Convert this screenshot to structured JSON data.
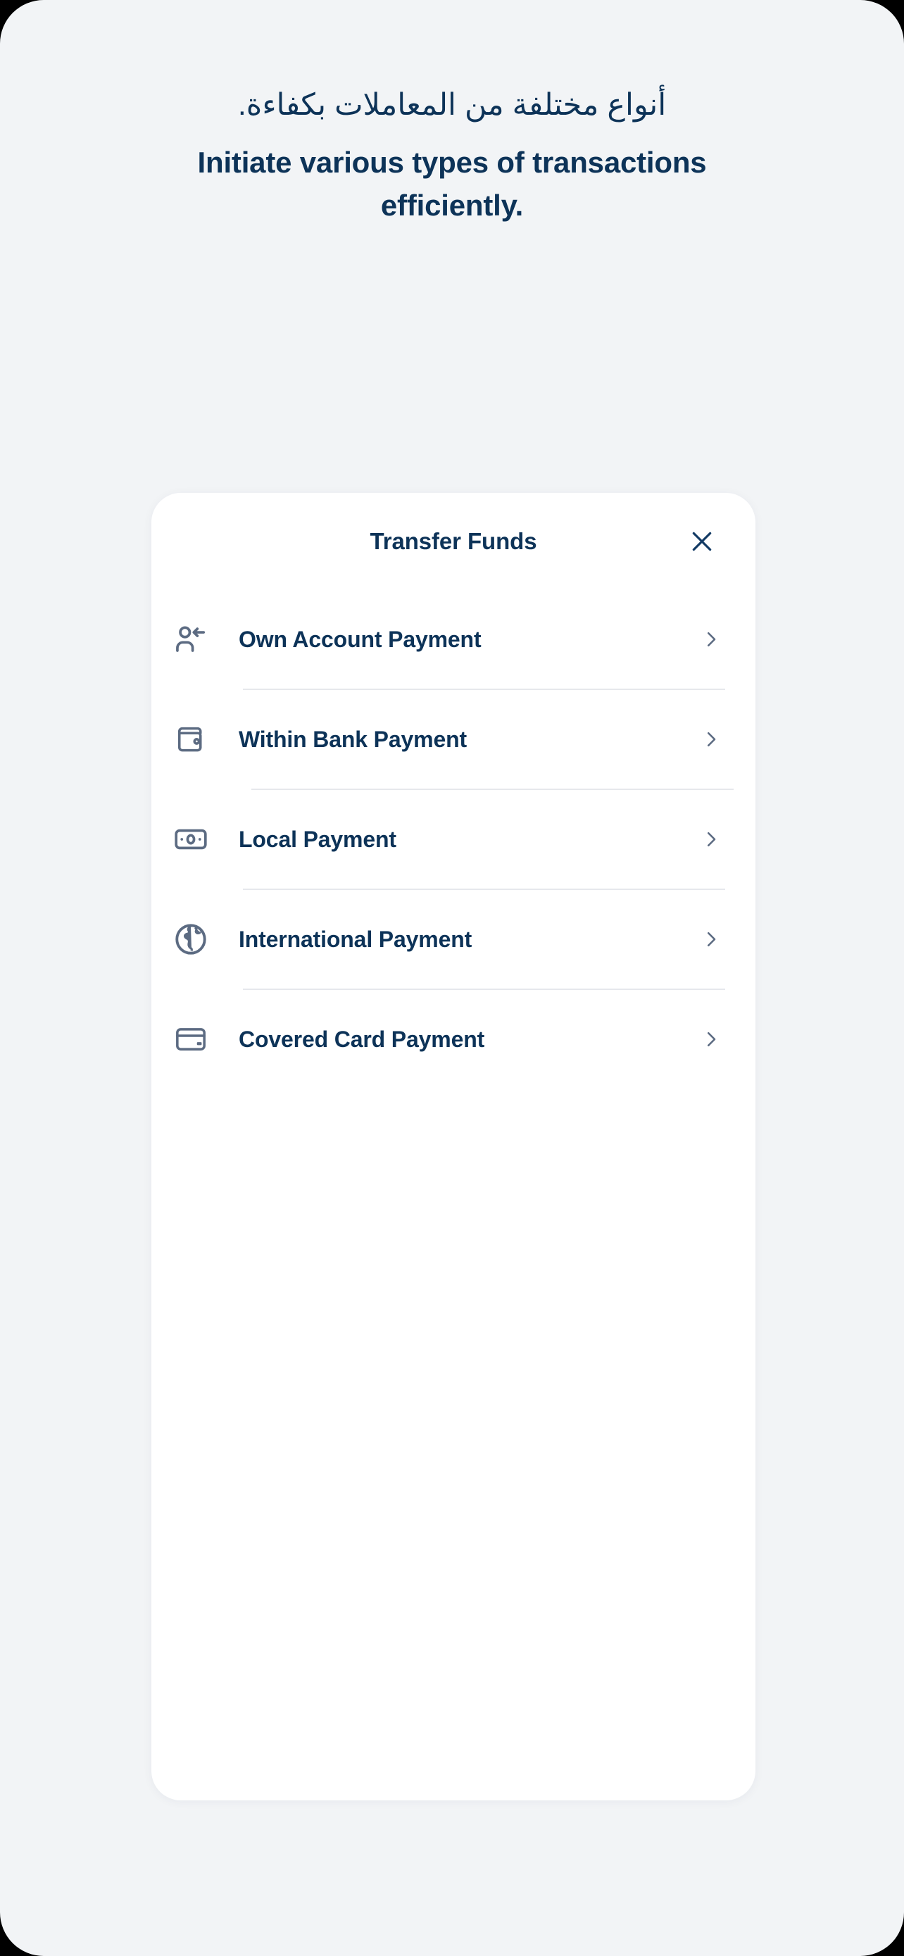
{
  "headline": {
    "arabic": "أنواع مختلفة من المعاملات بكفاءة.",
    "english": "Initiate various types of transactions efficiently."
  },
  "sheet": {
    "title": "Transfer Funds",
    "close_icon": "close-icon",
    "items": [
      {
        "label": "Own Account Payment",
        "icon": "person-arrow-left-icon",
        "chevron": "chevron-right-icon"
      },
      {
        "label": "Within Bank Payment",
        "icon": "wallet-icon",
        "chevron": "chevron-right-icon"
      },
      {
        "label": "Local Payment",
        "icon": "banknote-icon",
        "chevron": "chevron-right-icon"
      },
      {
        "label": "International Payment",
        "icon": "globe-icon",
        "chevron": "chevron-right-icon"
      },
      {
        "label": "Covered Card Payment",
        "icon": "credit-card-icon",
        "chevron": "chevron-right-icon"
      }
    ]
  },
  "colors": {
    "page_background": "#f2f4f6",
    "card_background": "#ffffff",
    "text_primary": "#0d3358",
    "icon_gray": "#5c6b82",
    "divider": "#e6e8ec",
    "outside_frame": "#000000"
  }
}
